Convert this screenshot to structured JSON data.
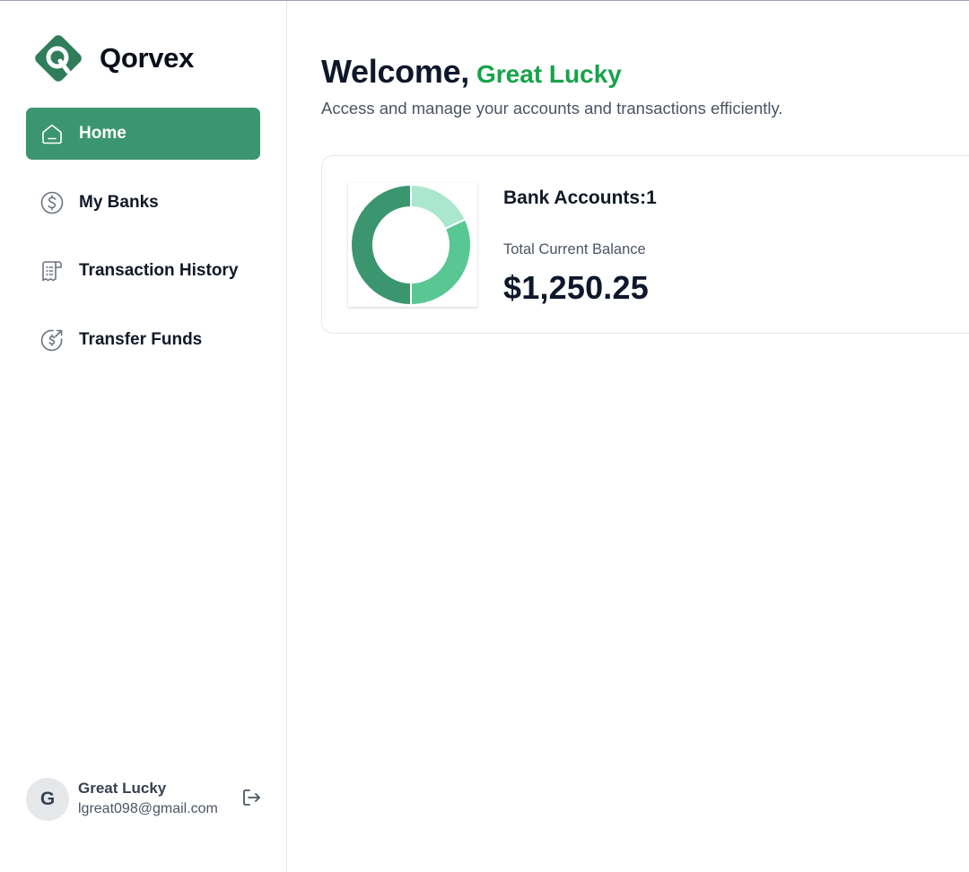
{
  "brand": {
    "name": "Qorvex",
    "logo_icon": "qorvex-logo-icon"
  },
  "nav": {
    "items": [
      {
        "label": "Home",
        "icon": "home-icon",
        "active": true
      },
      {
        "label": "My Banks",
        "icon": "dollar-circle-icon",
        "active": false
      },
      {
        "label": "Transaction History",
        "icon": "receipt-icon",
        "active": false
      },
      {
        "label": "Transfer Funds",
        "icon": "money-send-icon",
        "active": false
      }
    ]
  },
  "user": {
    "initial": "G",
    "name": "Great Lucky",
    "email": "lgreat098@gmail.com",
    "logout_icon": "logout-icon"
  },
  "header": {
    "welcome": "Welcome,",
    "name": "Great Lucky",
    "subtitle": "Access and manage your accounts and transactions efficiently."
  },
  "balance_card": {
    "accounts_label": "Bank Accounts:1",
    "balance_label": "Total Current Balance",
    "balance_value": "$1,250.25"
  },
  "chart_data": {
    "type": "pie",
    "donut": true,
    "values": [
      50,
      32,
      18
    ],
    "colors": [
      "#3b9670",
      "#58c793",
      "#abe7cf"
    ]
  },
  "colors": {
    "accent": "#3b9670",
    "name_green": "#16a34a"
  }
}
